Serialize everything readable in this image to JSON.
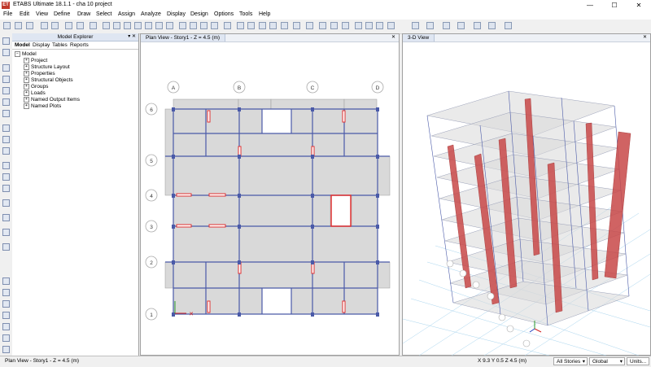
{
  "window": {
    "icon_text": "ET",
    "title": "ETABS Ultimate 18.1.1 - cha 10 project",
    "minimize": "—",
    "maximize": "☐",
    "close": "✕"
  },
  "menu": [
    "File",
    "Edit",
    "View",
    "Define",
    "Draw",
    "Select",
    "Assign",
    "Analyze",
    "Display",
    "Design",
    "Options",
    "Tools",
    "Help"
  ],
  "explorer": {
    "title": "Model Explorer",
    "tabs": [
      "Model",
      "Display",
      "Tables",
      "Reports"
    ],
    "root": "Model",
    "items": [
      "Project",
      "Structure Layout",
      "Properties",
      "Structural Objects",
      "Groups",
      "Loads",
      "Named Output Items",
      "Named Plots"
    ]
  },
  "plan": {
    "tab": "Plan View - Story1 - Z = 4.5 (m)",
    "cols": [
      "A",
      "B",
      "C",
      "D"
    ],
    "rows": [
      "6",
      "5",
      "4",
      "3",
      "2",
      "1"
    ]
  },
  "view3d": {
    "tab": "3-D View"
  },
  "status": {
    "left": "Plan View - Story1 - Z = 4.5 (m)",
    "coords": "X 9.3  Y 0.5  Z 4.5 (m)",
    "stories": "All Stories",
    "csys": "Global",
    "units": "Units..."
  },
  "colors": {
    "beam": "#4a5aa8",
    "wall": "#e03030",
    "slab": "#d9d9d9",
    "wall3d": "#c84848"
  }
}
